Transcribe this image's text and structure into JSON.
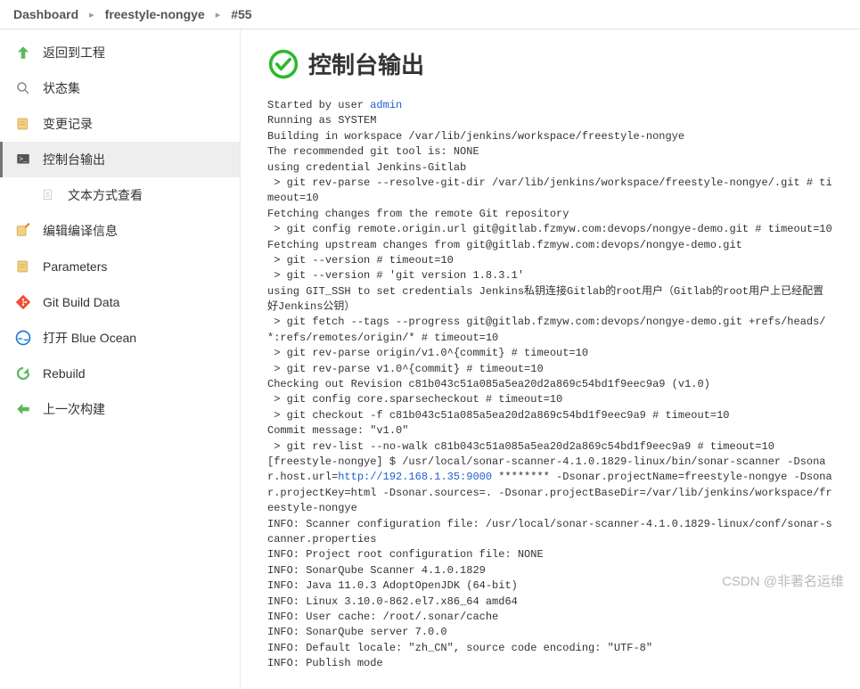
{
  "breadcrumb": {
    "items": [
      "Dashboard",
      "freestyle-nongye",
      "#55"
    ]
  },
  "sidebar": {
    "back": "返回到工程",
    "status": "状态集",
    "changes": "变更记录",
    "console": "控制台输出",
    "plaintext": "文本方式查看",
    "editbuild": "编辑编译信息",
    "parameters": "Parameters",
    "gitdata": "Git Build Data",
    "blueocean": "打开 Blue Ocean",
    "rebuild": "Rebuild",
    "prevbuild": "上一次构建"
  },
  "page": {
    "title": "控制台输出"
  },
  "console": {
    "prefix": "Started by user ",
    "user": "admin",
    "body1": "\nRunning as SYSTEM\nBuilding in workspace /var/lib/jenkins/workspace/freestyle-nongye\nThe recommended git tool is: NONE\nusing credential Jenkins-Gitlab\n > git rev-parse --resolve-git-dir /var/lib/jenkins/workspace/freestyle-nongye/.git # timeout=10\nFetching changes from the remote Git repository\n > git config remote.origin.url git@gitlab.fzmyw.com:devops/nongye-demo.git # timeout=10\nFetching upstream changes from git@gitlab.fzmyw.com:devops/nongye-demo.git\n > git --version # timeout=10\n > git --version # 'git version 1.8.3.1'\nusing GIT_SSH to set credentials Jenkins私钥连接Gitlab的root用户（Gitlab的root用户上已经配置好Jenkins公钥）\n > git fetch --tags --progress git@gitlab.fzmyw.com:devops/nongye-demo.git +refs/heads/*:refs/remotes/origin/* # timeout=10\n > git rev-parse origin/v1.0^{commit} # timeout=10\n > git rev-parse v1.0^{commit} # timeout=10\nChecking out Revision c81b043c51a085a5ea20d2a869c54bd1f9eec9a9 (v1.0)\n > git config core.sparsecheckout # timeout=10\n > git checkout -f c81b043c51a085a5ea20d2a869c54bd1f9eec9a9 # timeout=10\nCommit message: \"v1.0\"\n > git rev-list --no-walk c81b043c51a085a5ea20d2a869c54bd1f9eec9a9 # timeout=10\n[freestyle-nongye] $ /usr/local/sonar-scanner-4.1.0.1829-linux/bin/sonar-scanner -Dsonar.host.url=",
    "link2": "http://192.168.1.35:9000",
    "body2": " ******** -Dsonar.projectName=freestyle-nongye -Dsonar.projectKey=html -Dsonar.sources=. -Dsonar.projectBaseDir=/var/lib/jenkins/workspace/freestyle-nongye\nINFO: Scanner configuration file: /usr/local/sonar-scanner-4.1.0.1829-linux/conf/sonar-scanner.properties\nINFO: Project root configuration file: NONE\nINFO: SonarQube Scanner 4.1.0.1829\nINFO: Java 11.0.3 AdoptOpenJDK (64-bit)\nINFO: Linux 3.10.0-862.el7.x86_64 amd64\nINFO: User cache: /root/.sonar/cache\nINFO: SonarQube server 7.0.0\nINFO: Default locale: \"zh_CN\", source code encoding: \"UTF-8\"\nINFO: Publish mode"
  },
  "watermark": "CSDN @非著名运维"
}
